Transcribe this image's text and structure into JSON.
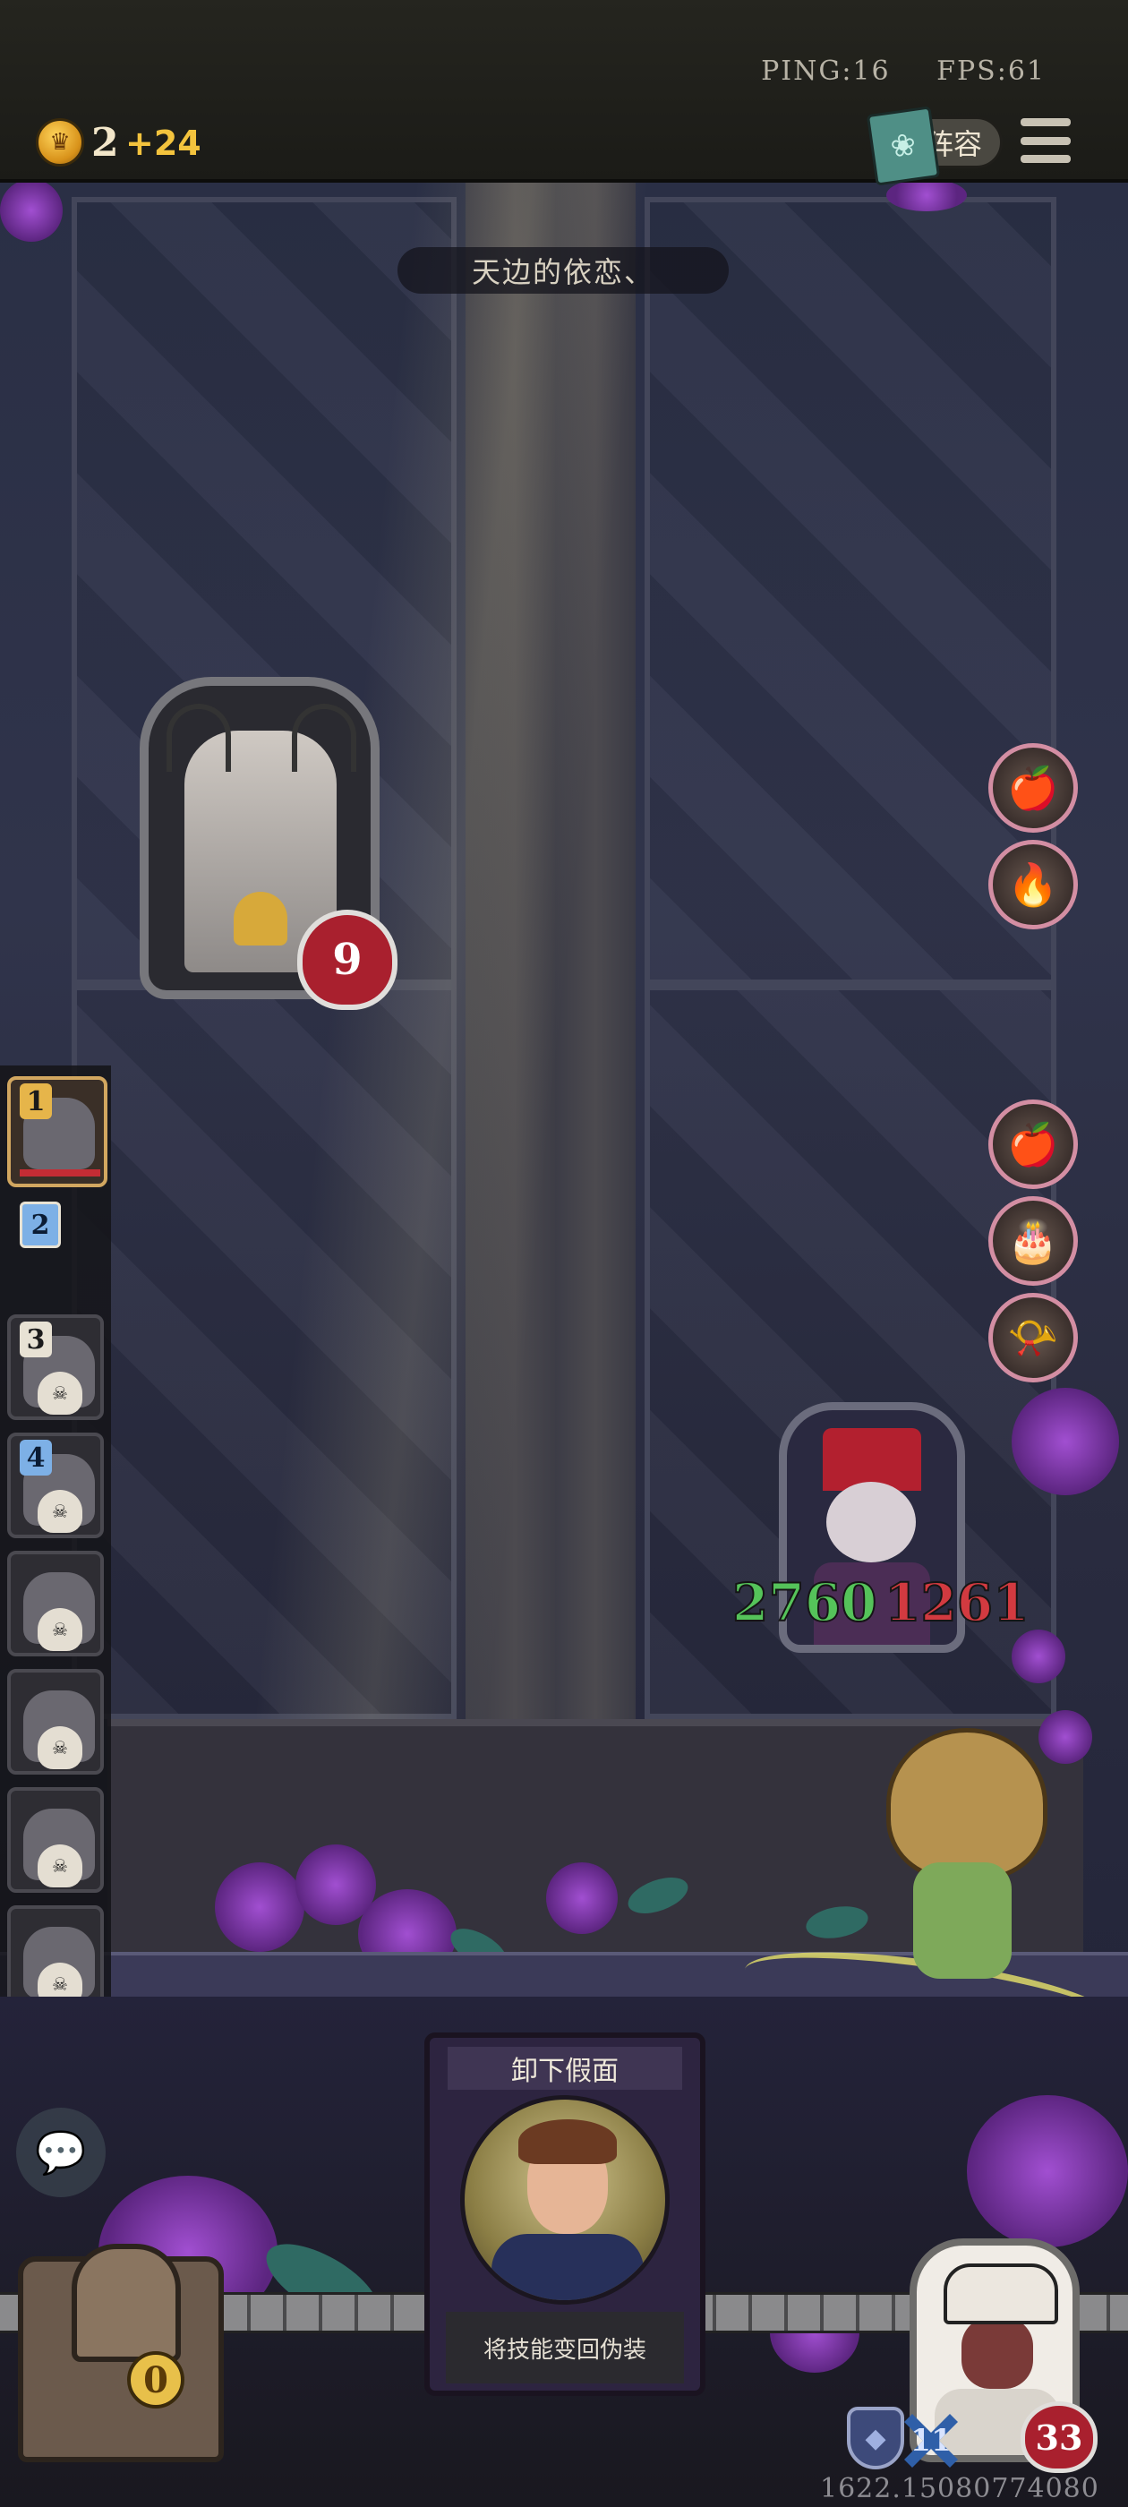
{
  "hud": {
    "ping": "PING:16",
    "fps": "FPS:61",
    "gold": "2",
    "gold_gain": "+24",
    "lineup_label": "阵容",
    "coin_icon": "crown-coin-icon",
    "menu_icon": "hamburger-menu-icon"
  },
  "stage": {
    "title": "天边的依恋、"
  },
  "boss": {
    "health": "9",
    "portrait": "stag-priest-portrait"
  },
  "relics_top": [
    "apples-icon",
    "campfire-icon"
  ],
  "relics_bottom": [
    "apples-icon",
    "cake-icon",
    "brass-horn-icon"
  ],
  "enemy": {
    "attack": "2760",
    "health": "1261",
    "portrait": "clown-portrait"
  },
  "turn_order": [
    {
      "num": "1",
      "state": "active",
      "style": "gold"
    },
    {
      "num": "2",
      "state": "queued",
      "style": "blue"
    },
    {
      "num": "3",
      "state": "dead",
      "style": "light"
    },
    {
      "num": "4",
      "state": "dead",
      "style": "blue"
    },
    {
      "num": "",
      "state": "dead",
      "style": "none"
    },
    {
      "num": "",
      "state": "dead",
      "style": "none"
    },
    {
      "num": "",
      "state": "dead",
      "style": "none"
    },
    {
      "num": "",
      "state": "dead",
      "style": "none"
    }
  ],
  "skill_card": {
    "title": "卸下假面",
    "description": "将技能变回伪装"
  },
  "chest": {
    "count": "0"
  },
  "player": {
    "armor": "11",
    "health": "33"
  },
  "footer": {
    "version": "1622.15080774080"
  },
  "colors": {
    "attack": "#55c35a",
    "health": "#d23a40",
    "gold_gain": "#f3c33d",
    "relic_border": "#d38ea3"
  }
}
